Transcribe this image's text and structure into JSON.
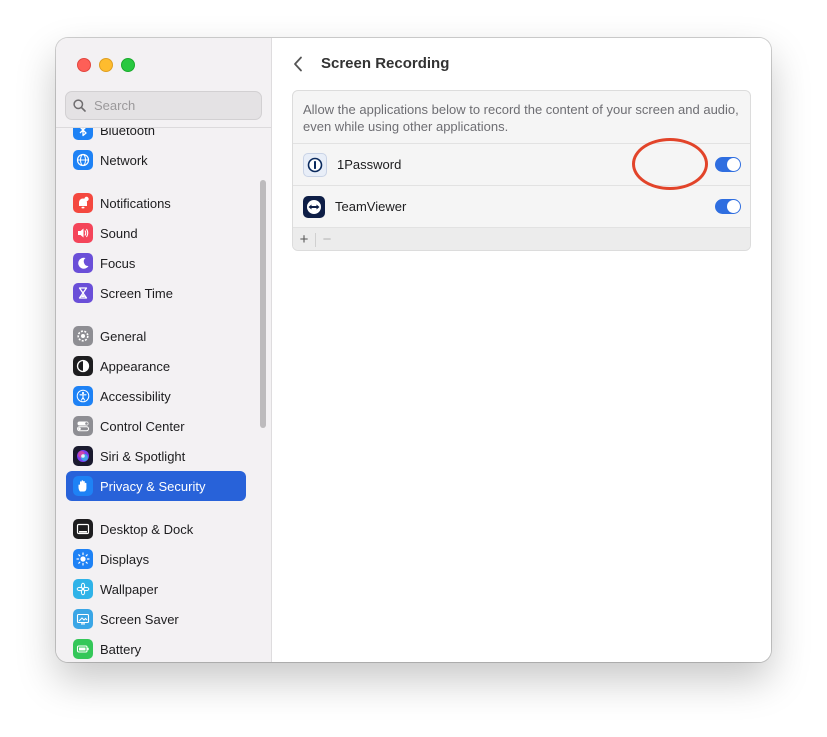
{
  "window": {
    "traffic_lights": [
      "close",
      "minimize",
      "zoom"
    ]
  },
  "search": {
    "placeholder": "Search"
  },
  "sidebar": {
    "items": [
      {
        "label": "Bluetooth",
        "icon": "bluetooth-icon",
        "color": "#1e82f5"
      },
      {
        "label": "Network",
        "icon": "globe-icon",
        "color": "#1e82f5"
      },
      {
        "label": "Notifications",
        "icon": "bell-icon",
        "color": "#f4483f"
      },
      {
        "label": "Sound",
        "icon": "speaker-icon",
        "color": "#f4455a"
      },
      {
        "label": "Focus",
        "icon": "moon-icon",
        "color": "#6a4fd8"
      },
      {
        "label": "Screen Time",
        "icon": "hourglass-icon",
        "color": "#6a4fd8"
      },
      {
        "label": "General",
        "icon": "gear-icon",
        "color": "#8e8e93"
      },
      {
        "label": "Appearance",
        "icon": "appearance-icon",
        "color": "#1d1d1f"
      },
      {
        "label": "Accessibility",
        "icon": "accessibility-icon",
        "color": "#1e82f5"
      },
      {
        "label": "Control Center",
        "icon": "control-center-icon",
        "color": "#8e8e93"
      },
      {
        "label": "Siri & Spotlight",
        "icon": "siri-icon",
        "color": "#5b3bd9"
      },
      {
        "label": "Privacy & Security",
        "icon": "hand-icon",
        "color": "#1e82f5",
        "selected": true
      },
      {
        "label": "Desktop & Dock",
        "icon": "dock-icon",
        "color": "#1d1d1f"
      },
      {
        "label": "Displays",
        "icon": "sun-icon",
        "color": "#1e82f5"
      },
      {
        "label": "Wallpaper",
        "icon": "flower-icon",
        "color": "#2fb3e8"
      },
      {
        "label": "Screen Saver",
        "icon": "screensaver-icon",
        "color": "#3aa6e6"
      },
      {
        "label": "Battery",
        "icon": "battery-icon",
        "color": "#34c759"
      }
    ]
  },
  "content": {
    "title": "Screen Recording",
    "description": "Allow the applications below to record the content of your screen and audio, even while using other applications.",
    "apps": [
      {
        "name": "1Password",
        "enabled": true,
        "icon": "onepassword-icon"
      },
      {
        "name": "TeamViewer",
        "enabled": true,
        "icon": "teamviewer-icon"
      }
    ],
    "add_label": "+",
    "remove_label": "−"
  },
  "colors": {
    "accent": "#2862d9",
    "toggle_on": "#2f6ee0",
    "annotation": "#e2442a"
  }
}
